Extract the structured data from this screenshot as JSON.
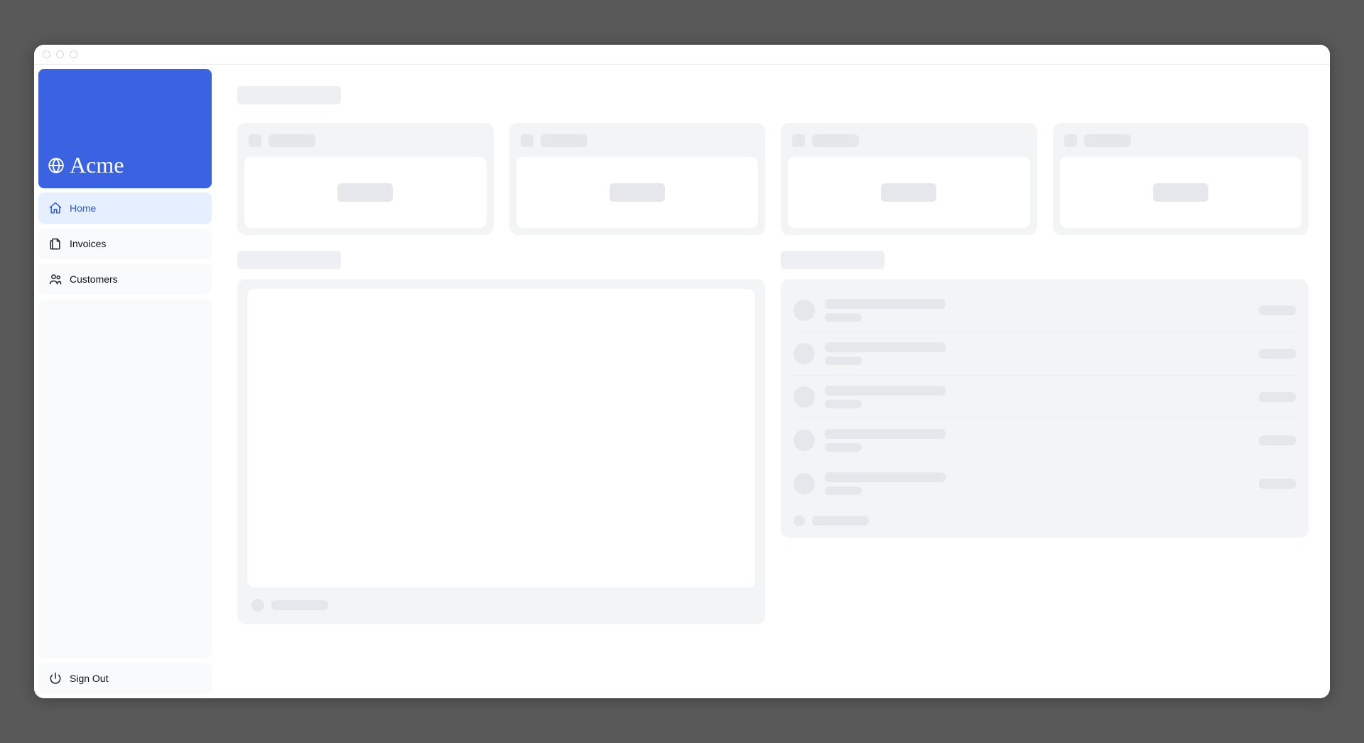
{
  "brand": {
    "name": "Acme"
  },
  "sidebar": {
    "items": [
      {
        "label": "Home",
        "active": true
      },
      {
        "label": "Invoices",
        "active": false
      },
      {
        "label": "Customers",
        "active": false
      }
    ],
    "sign_out_label": "Sign Out"
  },
  "colors": {
    "brand_blue": "#3b62e0",
    "active_bg": "#e6efff",
    "skeleton": "#e5e7ea",
    "panel": "#f3f4f6"
  }
}
